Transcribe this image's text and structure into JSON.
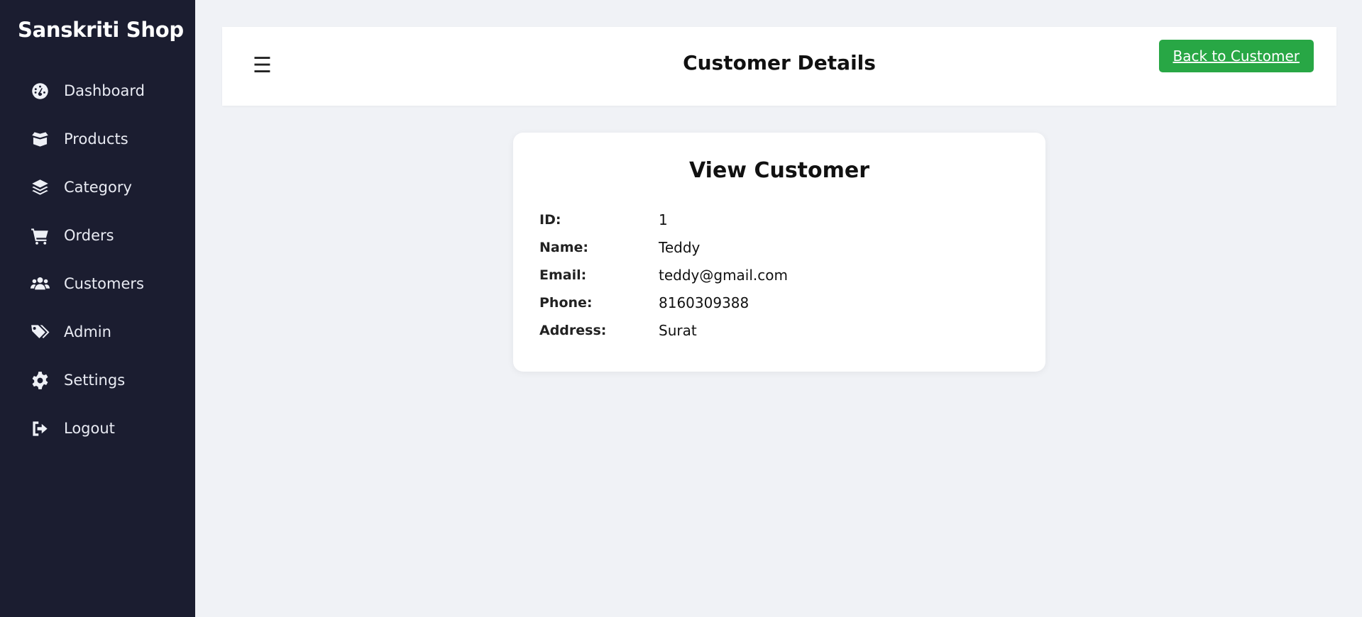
{
  "sidebar": {
    "brand": "Sanskriti Shop",
    "items": [
      {
        "label": "Dashboard",
        "icon": "dashboard-icon"
      },
      {
        "label": "Products",
        "icon": "box-open-icon"
      },
      {
        "label": "Category",
        "icon": "layers-icon"
      },
      {
        "label": "Orders",
        "icon": "cart-icon"
      },
      {
        "label": "Customers",
        "icon": "users-icon"
      },
      {
        "label": "Admin",
        "icon": "tags-icon"
      },
      {
        "label": "Settings",
        "icon": "gear-icon"
      },
      {
        "label": "Logout",
        "icon": "logout-icon"
      }
    ]
  },
  "header": {
    "menu_icon": "☰",
    "title": "Customer Details",
    "back_label": "Back to Customer"
  },
  "card": {
    "title": "View Customer",
    "fields": [
      {
        "label": "ID:",
        "value": "1"
      },
      {
        "label": "Name:",
        "value": "Teddy"
      },
      {
        "label": "Email:",
        "value": "teddy@gmail.com"
      },
      {
        "label": "Phone:",
        "value": "8160309388"
      },
      {
        "label": "Address:",
        "value": "Surat"
      }
    ]
  },
  "colors": {
    "sidebar_bg": "#1b1d30",
    "page_bg": "#f0f2f6",
    "accent_green": "#28a745"
  }
}
